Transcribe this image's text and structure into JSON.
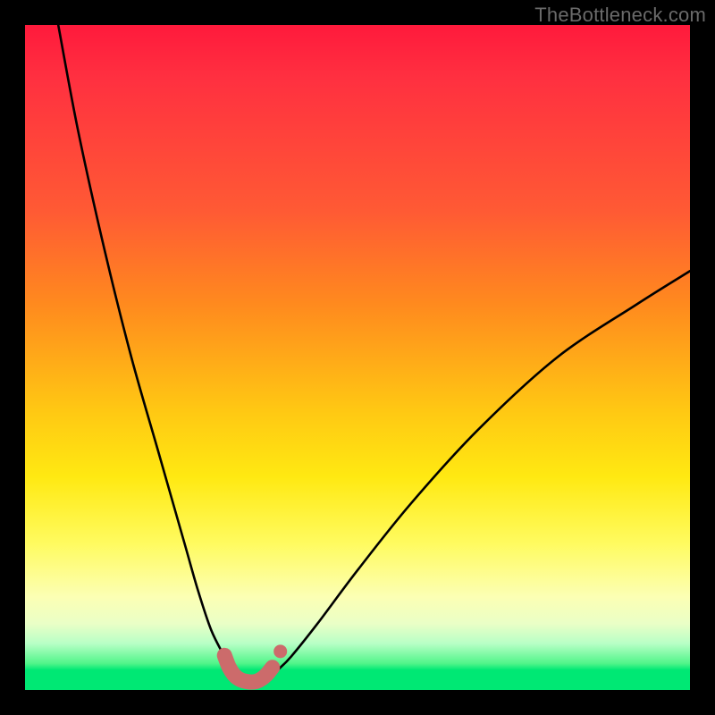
{
  "watermark": "TheBottleneck.com",
  "colors": {
    "frame": "#000000",
    "gradient_top": "#ff1a3c",
    "gradient_mid": "#ffe912",
    "gradient_bottom": "#00e874",
    "curve_stroke": "#000000",
    "marker_stroke": "#cc6b6b",
    "marker_fill": "#cc6b6b"
  },
  "chart_data": {
    "type": "line",
    "title": "",
    "xlabel": "",
    "ylabel": "",
    "xlim": [
      0,
      100
    ],
    "ylim": [
      0,
      100
    ],
    "series": [
      {
        "name": "bottleneck-curve",
        "x": [
          5,
          8,
          12,
          16,
          20,
          24,
          26,
          28,
          30,
          31,
          32,
          33,
          34,
          35,
          36,
          37,
          38,
          40,
          44,
          50,
          58,
          68,
          80,
          92,
          100
        ],
        "y": [
          100,
          84,
          66,
          50,
          36,
          22,
          15,
          9,
          5,
          3,
          2,
          1.5,
          1.2,
          1.2,
          1.5,
          2,
          3,
          5,
          10,
          18,
          28,
          39,
          50,
          58,
          63
        ]
      }
    ],
    "markers": {
      "name": "highlight-band",
      "x": [
        30,
        30.7,
        31.5,
        32.3,
        33.2,
        34,
        34.8,
        35.6,
        36.4,
        37.2,
        38.4
      ],
      "y": [
        5.2,
        3.4,
        2.2,
        1.6,
        1.3,
        1.2,
        1.3,
        1.7,
        2.4,
        3.4,
        5.8
      ]
    }
  }
}
